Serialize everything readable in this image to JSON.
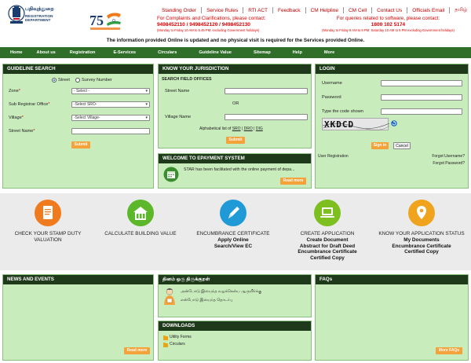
{
  "header": {
    "logo_tamil": "பதிவுத்துறை",
    "logo_english": "REGISTRATION DEPARTMENT",
    "azadi_number": "75"
  },
  "top_nav": [
    "Standing Order",
    "Service Rules",
    "RTI ACT",
    "Feedback",
    "CM Helpline",
    "CM Cell",
    "Contact Us",
    "Officials Email",
    "தமிழ்"
  ],
  "contact_left": {
    "title": "For Complaints and Clarifications, please contact:",
    "phones": "9498452110 / 9498452120 / 9498452130",
    "note": "(Monday to Friday 10 AM to 5.45 PM, excluding Government holidays)"
  },
  "contact_right": {
    "title": "For queries related to software, please contact:",
    "phone": "1800 102 5174",
    "note": "(Monday to Friday 8 AM to 8 PM; Saturday 10 AM to 5 PM excluding Government holidays)"
  },
  "info_line": "The information provided Online is updated and no physical visit is required for the Services provided Online.",
  "menu": [
    "Home",
    "About us",
    "Registration",
    "E-Services",
    "Circulars",
    "Guideline Value",
    "Sitemap",
    "Help",
    "More"
  ],
  "guideline": {
    "title": "GUIDELINE SEARCH",
    "radio_street": "Street",
    "radio_survey": "Survey Number",
    "zone_label": "Zone",
    "zone_value": "- Select -",
    "sro_label": "Sub Registrar Office",
    "sro_value": "-Select SRO-",
    "village_label": "Village",
    "village_value": "-Select Village-",
    "street_label": "Street Name",
    "required_mark": "*",
    "submit": "Submit"
  },
  "jurisdiction": {
    "title": "KNOW YOUR JURISDICTION",
    "subtitle": "SEARCH FIELD OFFICES",
    "street_label": "Street Name",
    "or_text": "OR",
    "village_label": "Village Name",
    "alpha_text": "Alphabetical list of",
    "sro": "SRO",
    "dro": "DRO",
    "dig": "DIG",
    "sep": "|",
    "submit": "Submit"
  },
  "epayment": {
    "title": "WELCOME TO ePAYMENT SYSTEM",
    "text": "STAR has been facilitated with the online payment of depa...",
    "read_more": "Read more"
  },
  "login": {
    "title": "LOGIN",
    "username_label": "Username",
    "password_label": "Password",
    "captcha_label": "Type the code shown",
    "captcha_text": "XKDCD",
    "sign_in": "Sign in",
    "cancel": "Cancel",
    "user_registration": "User Registration",
    "forgot_username": "Forgot Username?",
    "forgot_password": "Forgot Password?"
  },
  "services": [
    {
      "title": "CHECK YOUR STAMP DUTY VALUATION",
      "color": "#f07a1e",
      "icon": "document-icon",
      "subs": []
    },
    {
      "title": "CALCULATE BUILDING VALUE",
      "color": "#5cb82a",
      "icon": "building-icon",
      "subs": []
    },
    {
      "title": "ENCUMBRANCE CERTIFICATE",
      "color": "#1f9ad6",
      "icon": "pen-icon",
      "subs": [
        "Apply Online",
        "Search/View EC"
      ]
    },
    {
      "title": "CREATE APPLICATION",
      "color": "#7cbf1e",
      "icon": "laptop-icon",
      "subs": [
        "Create Document",
        "Abstract for Draft Deed",
        "Encumbrance Certificate",
        "Certified Copy"
      ]
    },
    {
      "title": "KNOW YOUR APPLICATION STATUS",
      "color": "#f0a41e",
      "icon": "location-pin-icon",
      "subs": [
        "My Documents",
        "Encumbrance Certificate",
        "Certified Copy"
      ]
    }
  ],
  "news": {
    "title": "NEWS AND EVENTS",
    "read_more": "Read more"
  },
  "kural": {
    "title": "தினம் ஒரு திருக்குறள்",
    "line1": "அன்போடு இயைந்த வழக்கென்ப ஆருயிர்க்கு",
    "line2": "என்போடு இயைந்த தொடர்பு"
  },
  "downloads": {
    "title": "DOWNLOADS",
    "items": [
      "Utility Forms",
      "Circulars"
    ]
  },
  "faqs": {
    "title": "FAQs",
    "more": "More FAQs"
  },
  "colors": {
    "menu_bg": "#2f6f2a",
    "panel_bg": "#c9ecbd",
    "panel_header": "#1f3a1b",
    "button_orange": "#f6a23a",
    "contact_red": "#d00000"
  }
}
